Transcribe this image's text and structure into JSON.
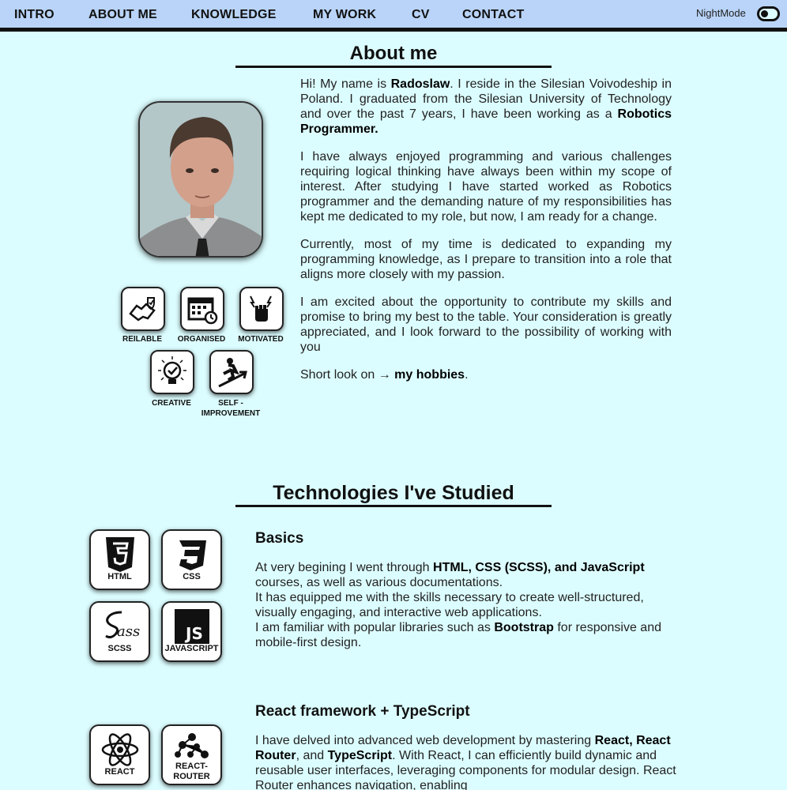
{
  "nav": {
    "items": [
      "INTRO",
      "ABOUT ME",
      "KNOWLEDGE",
      "MY WORK",
      "CV",
      "CONTACT"
    ],
    "night_label": "NightMode"
  },
  "about": {
    "heading": "About me",
    "p1": {
      "a": "Hi! My name is ",
      "name": "Radoslaw",
      "b": ". I reside in the Silesian Voivodeship in Poland. I graduated from the Silesian University of Technology and over the past 7 years, I have been working as a ",
      "role": "Robotics Programmer."
    },
    "p2": "I have always enjoyed programming and various challenges requiring logical thinking have always been within my scope of interest. After studying I have started worked as Robotics programmer and the demanding nature of my responsibilities has kept me dedicated to my role, but now, I am ready for a change.",
    "p3": "Currently, most of my time is dedicated to expanding my programming knowledge, as I prepare to transition into a role that aligns more closely with my passion.",
    "p4": "I am excited about the opportunity to contribute my skills and promise to bring my best to the table. Your consideration is greatly appreciated, and I look forward to the possibility of working with you",
    "hobbies": {
      "a": "Short look on → ",
      "link": "my hobbies",
      "b": "."
    },
    "traits": [
      "REILABLE",
      "ORGANISED",
      "MOTIVATED",
      "CREATIVE",
      "SELF - IMPROVEMENT"
    ]
  },
  "tech": {
    "heading": "Technologies I've Studied",
    "basics": {
      "title": "Basics",
      "t1": "At very begining I went through ",
      "t1b": "HTML, CSS (SCSS), and JavaScript",
      "t2": " courses, as well as various documentations.",
      "t3": "It has equipped me with the skills necessary to create well-structured, visually engaging, and interactive web applications.",
      "t4": "I am familiar with popular libraries such as ",
      "t4b": "Bootstrap",
      "t5": " for responsive and mobile-first design.",
      "tiles": [
        "HTML",
        "CSS",
        "SCSS",
        "JAVASCRIPT"
      ]
    },
    "react": {
      "title": "React framework + TypeScript",
      "t1": "I have delved into advanced web development by mastering ",
      "t1b": "React, React Router",
      "t2": ", and ",
      "t2b": "TypeScript",
      "t3": ". With React, I can efficiently build dynamic and reusable user interfaces, leveraging components for modular design. React Router enhances navigation, enabling",
      "tiles": [
        "REACT",
        "REACT-ROUTER"
      ]
    }
  }
}
